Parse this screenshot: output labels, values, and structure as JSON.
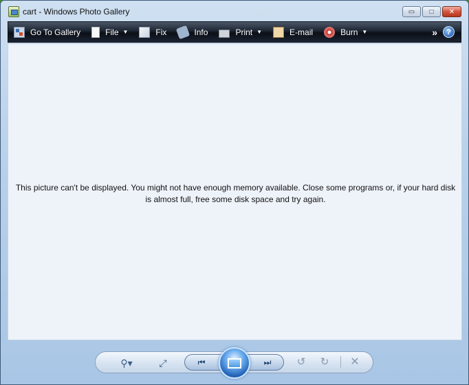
{
  "window": {
    "title": "cart - Windows Photo Gallery",
    "controls": {
      "minimize": "▭",
      "maximize": "□",
      "close": "✕"
    }
  },
  "toolbar": {
    "items": [
      {
        "label": "Go To Gallery",
        "icon": "gallery-icon",
        "has_menu": false
      },
      {
        "label": "File",
        "icon": "file-icon",
        "has_menu": true
      },
      {
        "label": "Fix",
        "icon": "fix-icon",
        "has_menu": false
      },
      {
        "label": "Info",
        "icon": "info-icon",
        "has_menu": false
      },
      {
        "label": "Print",
        "icon": "print-icon",
        "has_menu": true
      },
      {
        "label": "E-mail",
        "icon": "email-icon",
        "has_menu": false
      },
      {
        "label": "Burn",
        "icon": "burn-icon",
        "has_menu": true
      }
    ],
    "overflow": "»",
    "help": "?"
  },
  "content": {
    "message": "This picture can't be displayed. You might not have enough memory available.  Close some programs or, if your hard disk is almost full, free some disk space and try again."
  },
  "controls": {
    "zoom": "⚲▾",
    "fit": "⤢",
    "previous": "⏮",
    "next": "⏭",
    "rotate_left": "↺",
    "rotate_right": "↻",
    "delete": "✕"
  },
  "colors": {
    "toolbar_bg": "#1d2532",
    "content_bg": "#eef3fa",
    "accent": "#1d5fb4"
  }
}
